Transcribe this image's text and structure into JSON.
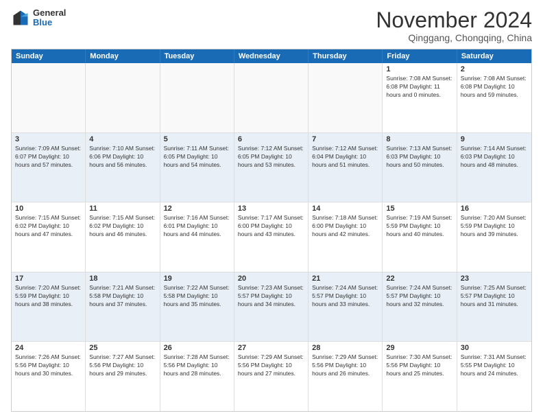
{
  "logo": {
    "general": "General",
    "blue": "Blue"
  },
  "title": "November 2024",
  "subtitle": "Qinggang, Chongqing, China",
  "days_of_week": [
    "Sunday",
    "Monday",
    "Tuesday",
    "Wednesday",
    "Thursday",
    "Friday",
    "Saturday"
  ],
  "weeks": [
    [
      {
        "day": "",
        "info": ""
      },
      {
        "day": "",
        "info": ""
      },
      {
        "day": "",
        "info": ""
      },
      {
        "day": "",
        "info": ""
      },
      {
        "day": "",
        "info": ""
      },
      {
        "day": "1",
        "info": "Sunrise: 7:08 AM\nSunset: 6:08 PM\nDaylight: 11 hours\nand 0 minutes."
      },
      {
        "day": "2",
        "info": "Sunrise: 7:08 AM\nSunset: 6:08 PM\nDaylight: 10 hours\nand 59 minutes."
      }
    ],
    [
      {
        "day": "3",
        "info": "Sunrise: 7:09 AM\nSunset: 6:07 PM\nDaylight: 10 hours\nand 57 minutes."
      },
      {
        "day": "4",
        "info": "Sunrise: 7:10 AM\nSunset: 6:06 PM\nDaylight: 10 hours\nand 56 minutes."
      },
      {
        "day": "5",
        "info": "Sunrise: 7:11 AM\nSunset: 6:05 PM\nDaylight: 10 hours\nand 54 minutes."
      },
      {
        "day": "6",
        "info": "Sunrise: 7:12 AM\nSunset: 6:05 PM\nDaylight: 10 hours\nand 53 minutes."
      },
      {
        "day": "7",
        "info": "Sunrise: 7:12 AM\nSunset: 6:04 PM\nDaylight: 10 hours\nand 51 minutes."
      },
      {
        "day": "8",
        "info": "Sunrise: 7:13 AM\nSunset: 6:03 PM\nDaylight: 10 hours\nand 50 minutes."
      },
      {
        "day": "9",
        "info": "Sunrise: 7:14 AM\nSunset: 6:03 PM\nDaylight: 10 hours\nand 48 minutes."
      }
    ],
    [
      {
        "day": "10",
        "info": "Sunrise: 7:15 AM\nSunset: 6:02 PM\nDaylight: 10 hours\nand 47 minutes."
      },
      {
        "day": "11",
        "info": "Sunrise: 7:15 AM\nSunset: 6:02 PM\nDaylight: 10 hours\nand 46 minutes."
      },
      {
        "day": "12",
        "info": "Sunrise: 7:16 AM\nSunset: 6:01 PM\nDaylight: 10 hours\nand 44 minutes."
      },
      {
        "day": "13",
        "info": "Sunrise: 7:17 AM\nSunset: 6:00 PM\nDaylight: 10 hours\nand 43 minutes."
      },
      {
        "day": "14",
        "info": "Sunrise: 7:18 AM\nSunset: 6:00 PM\nDaylight: 10 hours\nand 42 minutes."
      },
      {
        "day": "15",
        "info": "Sunrise: 7:19 AM\nSunset: 5:59 PM\nDaylight: 10 hours\nand 40 minutes."
      },
      {
        "day": "16",
        "info": "Sunrise: 7:20 AM\nSunset: 5:59 PM\nDaylight: 10 hours\nand 39 minutes."
      }
    ],
    [
      {
        "day": "17",
        "info": "Sunrise: 7:20 AM\nSunset: 5:59 PM\nDaylight: 10 hours\nand 38 minutes."
      },
      {
        "day": "18",
        "info": "Sunrise: 7:21 AM\nSunset: 5:58 PM\nDaylight: 10 hours\nand 37 minutes."
      },
      {
        "day": "19",
        "info": "Sunrise: 7:22 AM\nSunset: 5:58 PM\nDaylight: 10 hours\nand 35 minutes."
      },
      {
        "day": "20",
        "info": "Sunrise: 7:23 AM\nSunset: 5:57 PM\nDaylight: 10 hours\nand 34 minutes."
      },
      {
        "day": "21",
        "info": "Sunrise: 7:24 AM\nSunset: 5:57 PM\nDaylight: 10 hours\nand 33 minutes."
      },
      {
        "day": "22",
        "info": "Sunrise: 7:24 AM\nSunset: 5:57 PM\nDaylight: 10 hours\nand 32 minutes."
      },
      {
        "day": "23",
        "info": "Sunrise: 7:25 AM\nSunset: 5:57 PM\nDaylight: 10 hours\nand 31 minutes."
      }
    ],
    [
      {
        "day": "24",
        "info": "Sunrise: 7:26 AM\nSunset: 5:56 PM\nDaylight: 10 hours\nand 30 minutes."
      },
      {
        "day": "25",
        "info": "Sunrise: 7:27 AM\nSunset: 5:56 PM\nDaylight: 10 hours\nand 29 minutes."
      },
      {
        "day": "26",
        "info": "Sunrise: 7:28 AM\nSunset: 5:56 PM\nDaylight: 10 hours\nand 28 minutes."
      },
      {
        "day": "27",
        "info": "Sunrise: 7:29 AM\nSunset: 5:56 PM\nDaylight: 10 hours\nand 27 minutes."
      },
      {
        "day": "28",
        "info": "Sunrise: 7:29 AM\nSunset: 5:56 PM\nDaylight: 10 hours\nand 26 minutes."
      },
      {
        "day": "29",
        "info": "Sunrise: 7:30 AM\nSunset: 5:56 PM\nDaylight: 10 hours\nand 25 minutes."
      },
      {
        "day": "30",
        "info": "Sunrise: 7:31 AM\nSunset: 5:55 PM\nDaylight: 10 hours\nand 24 minutes."
      }
    ]
  ]
}
